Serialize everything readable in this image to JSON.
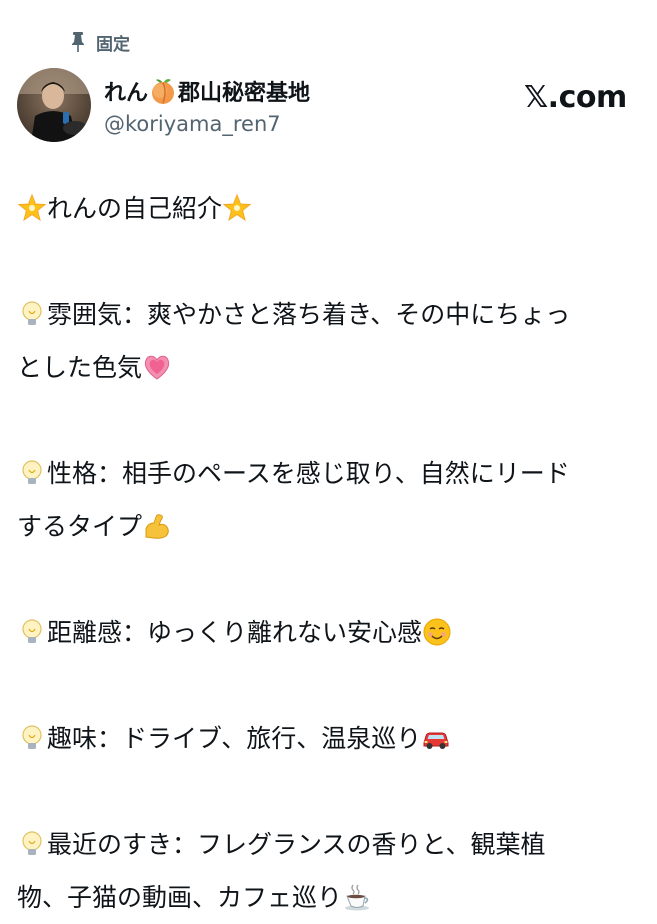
{
  "pinned": {
    "label": "固定",
    "icon": "pin-icon"
  },
  "author": {
    "display_name": "れん",
    "name_emoji": "peach-icon",
    "display_name_suffix": "郡山秘密基地",
    "handle": "@koriyama_ren7"
  },
  "brand": {
    "label": "𝕏.com"
  },
  "post": {
    "title": {
      "prefix_icon": "glowing-star-icon",
      "text": "れんの自己紹介",
      "suffix_icon": "glowing-star-icon"
    },
    "items": [
      {
        "icon": "light-bulb-icon",
        "line1": "雰囲気：爽やかさと落ち着き、その中にちょっ",
        "line2": "とした色気",
        "end_icon": "growing-heart-icon"
      },
      {
        "icon": "light-bulb-icon",
        "line1": "性格：相手のペースを感じ取り、自然にリード",
        "line2": "するタイプ",
        "end_icon": "flexed-biceps-icon"
      },
      {
        "icon": "light-bulb-icon",
        "line1": "距離感：ゆっくり離れない安心感",
        "end_icon": "smiling-face-icon"
      },
      {
        "icon": "light-bulb-icon",
        "line1": "趣味：ドライブ、旅行、温泉巡り",
        "end_icon": "car-icon"
      },
      {
        "icon": "light-bulb-icon",
        "line1": "最近のすき：フレグランスの香りと、観葉植",
        "line2": "物、子猫の動画、カフェ巡り",
        "end_icon": "hot-beverage-icon"
      }
    ]
  },
  "colors": {
    "text": "#0f1419",
    "secondary": "#536471",
    "background": "#ffffff"
  }
}
